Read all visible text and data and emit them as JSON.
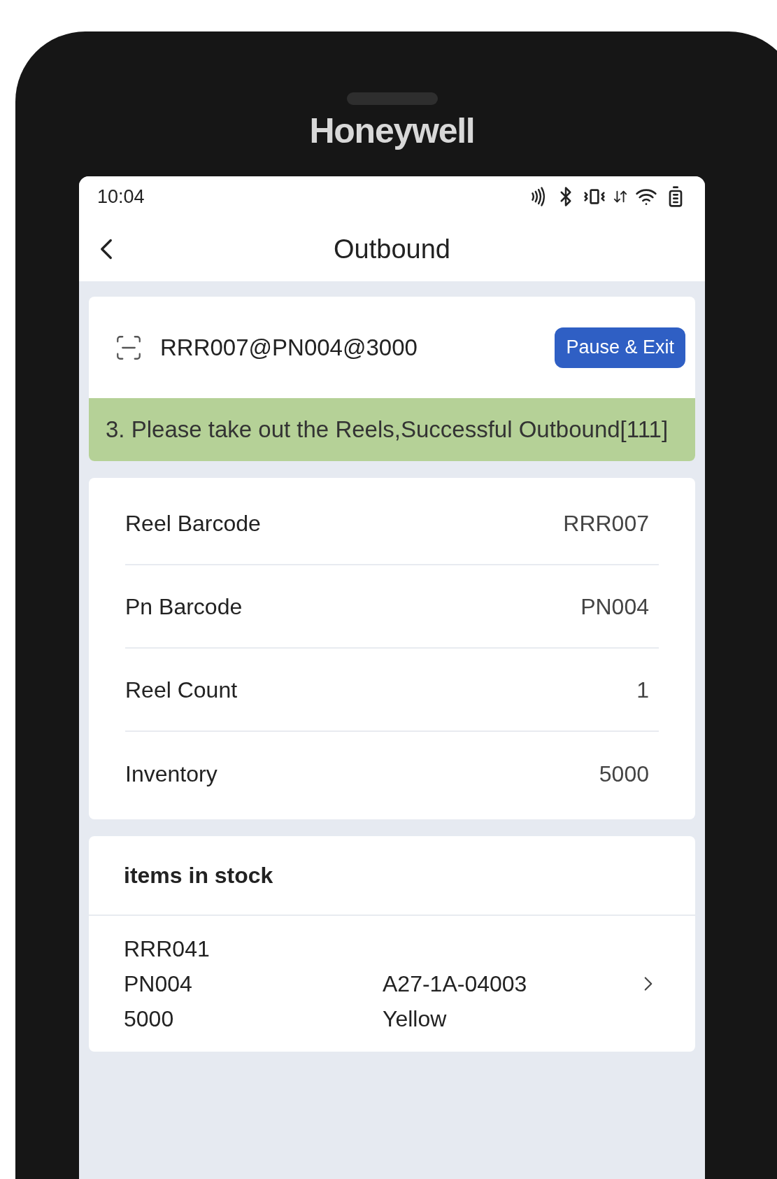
{
  "device": {
    "brand": "Honeywell"
  },
  "status_bar": {
    "time": "10:04"
  },
  "header": {
    "title": "Outbound"
  },
  "scan": {
    "value": "RRR007@PN004@3000",
    "button": "Pause & Exit"
  },
  "message": "3. Please take out the Reels,Successful Outbound[111]",
  "details": [
    {
      "label": "Reel Barcode",
      "value": "RRR007"
    },
    {
      "label": "Pn Barcode",
      "value": "PN004"
    },
    {
      "label": "Reel Count",
      "value": "1"
    },
    {
      "label": "Inventory",
      "value": "5000"
    }
  ],
  "stock": {
    "title": "items in stock",
    "items": [
      {
        "column_1": [
          "RRR041",
          "PN004",
          "5000"
        ],
        "column_2": [
          "A27-1A-04003",
          "Yellow"
        ]
      }
    ]
  }
}
